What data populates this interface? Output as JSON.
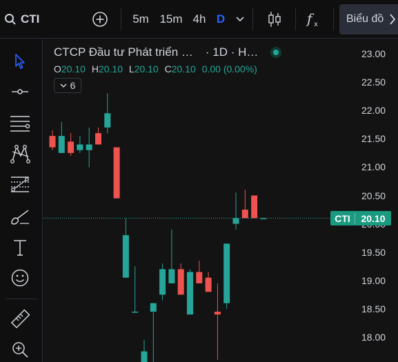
{
  "toolbar": {
    "symbol": "CTI",
    "timeframes": [
      "5m",
      "15m",
      "4h",
      "D"
    ],
    "active_timeframe": "D",
    "chart_type_label": "Biểu đồ"
  },
  "legend": {
    "title": "CTCP Đầu tư Phát triển …",
    "interval": "· 1D · H…",
    "ohlc": {
      "o_label": "O",
      "o": "20.10",
      "h_label": "H",
      "h": "20.10",
      "l_label": "L",
      "l": "20.10",
      "c_label": "C",
      "c": "20.10",
      "change": "0.00 (0.00%)"
    },
    "indicators_count": "6"
  },
  "price_axis": {
    "ticks": [
      "23.00",
      "22.50",
      "22.00",
      "21.50",
      "21.00",
      "20.50",
      "20.00",
      "19.50",
      "19.00",
      "18.50",
      "18.00"
    ],
    "current_symbol": "CTI",
    "current_price": "20.10"
  },
  "colors": {
    "up": "#26a69a",
    "down": "#ef5350",
    "accent": "#2962ff"
  },
  "chart_data": {
    "type": "candlestick",
    "ylim": [
      17.6,
      23.1
    ],
    "candles": [
      {
        "o": 21.55,
        "h": 21.65,
        "l": 21.3,
        "c": 21.35
      },
      {
        "o": 21.25,
        "h": 21.8,
        "l": 21.25,
        "c": 21.55
      },
      {
        "o": 21.45,
        "h": 21.6,
        "l": 21.2,
        "c": 21.25
      },
      {
        "o": 21.3,
        "h": 21.55,
        "l": 21.25,
        "c": 21.4
      },
      {
        "o": 21.3,
        "h": 21.7,
        "l": 21.0,
        "c": 21.4
      },
      {
        "o": 21.6,
        "h": 21.7,
        "l": 21.4,
        "c": 21.4
      },
      {
        "o": 21.7,
        "h": 22.3,
        "l": 21.6,
        "c": 21.95
      },
      {
        "o": 21.35,
        "h": 21.35,
        "l": 20.45,
        "c": 20.45
      },
      {
        "o": 19.05,
        "h": 20.1,
        "l": 19.05,
        "c": 19.8
      },
      {
        "o": 18.45,
        "h": 19.25,
        "l": 18.45,
        "c": 18.45
      },
      {
        "o": 17.55,
        "h": 17.95,
        "l": 17.55,
        "c": 17.75
      },
      {
        "o": 18.45,
        "h": 18.6,
        "l": 17.55,
        "c": 18.6
      },
      {
        "o": 18.75,
        "h": 19.3,
        "l": 18.65,
        "c": 19.2
      },
      {
        "o": 18.95,
        "h": 19.9,
        "l": 18.95,
        "c": 19.2
      },
      {
        "o": 19.2,
        "h": 19.3,
        "l": 18.75,
        "c": 18.75
      },
      {
        "o": 18.4,
        "h": 19.2,
        "l": 18.4,
        "c": 19.15
      },
      {
        "o": 19.15,
        "h": 19.35,
        "l": 18.95,
        "c": 18.95
      },
      {
        "o": 19.05,
        "h": 19.15,
        "l": 18.8,
        "c": 18.8
      },
      {
        "o": 18.45,
        "h": 18.95,
        "l": 17.6,
        "c": 18.4
      },
      {
        "o": 18.6,
        "h": 19.65,
        "l": 18.5,
        "c": 19.65
      },
      {
        "o": 20.0,
        "h": 20.55,
        "l": 19.9,
        "c": 20.1
      },
      {
        "o": 20.25,
        "h": 20.6,
        "l": 20.1,
        "c": 20.1
      },
      {
        "o": 20.5,
        "h": 20.5,
        "l": 20.1,
        "c": 20.1
      },
      {
        "o": 20.1,
        "h": 20.1,
        "l": 20.1,
        "c": 20.1
      }
    ]
  }
}
